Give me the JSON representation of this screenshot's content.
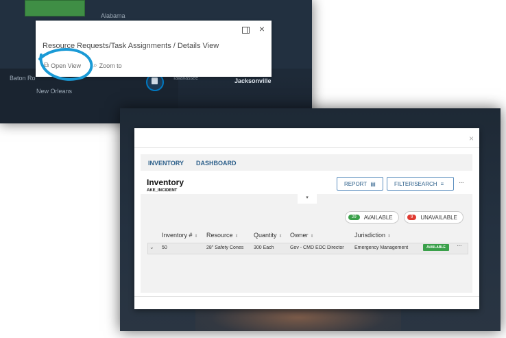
{
  "map_top": {
    "labels": {
      "alabama": "Alabama",
      "baton_rouge": "Baton Ro",
      "new_orleans": "New Orleans",
      "jacksonville": "Jacksonville",
      "tallahassee": "Tallahassee"
    },
    "popup": {
      "title": "Resource Requests/Task Assignments / Details View",
      "open_view": "Open View",
      "zoom_to": "Zoom to"
    }
  },
  "modal": {
    "close": "×",
    "tabs": [
      {
        "label": "INVENTORY",
        "active": true
      },
      {
        "label": "DASHBOARD",
        "active": false
      }
    ],
    "title": "Inventory",
    "subtitle": "AKE_INCIDENT",
    "report_label": "REPORT",
    "filter_label": "FILTER/SEARCH",
    "more": "···",
    "collapse_icon": "▾",
    "available": {
      "count": "29",
      "label": "AVAILABLE",
      "color": "#3aa04a"
    },
    "unavailable": {
      "count": "9",
      "label": "UNAVAILABLE",
      "color": "#e03b32"
    },
    "table": {
      "columns": [
        "Inventory #",
        "Resource",
        "Quantity",
        "Owner",
        "Jurisdiction"
      ],
      "rows": [
        {
          "inventory": "50",
          "resource": "28\" Safety Cones",
          "quantity": "300 Each",
          "owner": "Gov - CMD EOC Director",
          "jurisdiction": "Emergency Management",
          "status": "AVAILABLE"
        }
      ]
    }
  },
  "colors": {
    "accent": "#2c5f8a",
    "highlight_circle": "#1a9ad6",
    "available": "#3aa04a",
    "unavailable": "#e03b32"
  }
}
